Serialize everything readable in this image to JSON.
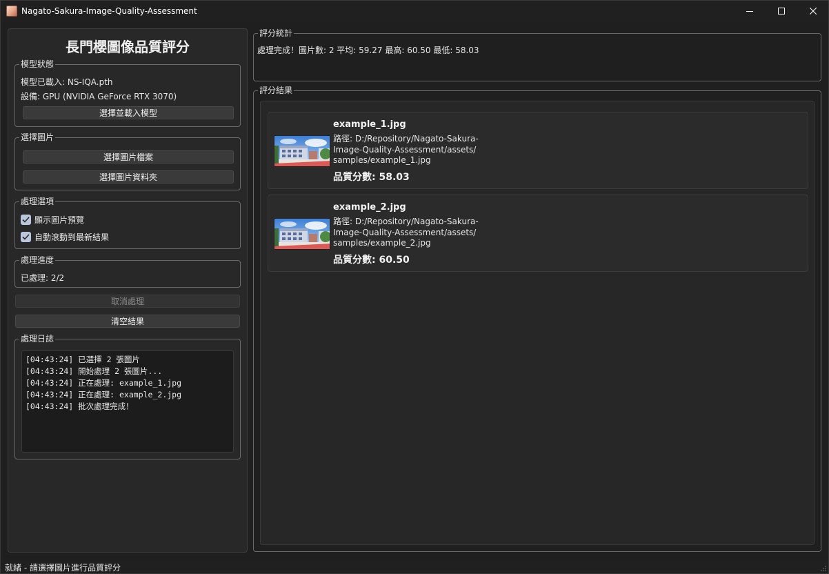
{
  "window": {
    "title": "Nagato-Sakura-Image-Quality-Assessment"
  },
  "app": {
    "heading": "長門櫻圖像品質評分"
  },
  "model_status": {
    "legend": "模型狀態",
    "loaded_text": "模型已載入: NS-IQA.pth",
    "device_text": "設備: GPU (NVIDIA GeForce RTX 3070)",
    "load_button": "選擇並載入模型"
  },
  "select_image": {
    "legend": "選擇圖片",
    "file_button": "選擇圖片檔案",
    "folder_button": "選擇圖片資料夾"
  },
  "options": {
    "legend": "處理選項",
    "show_preview": {
      "label": "顯示圖片預覽",
      "checked": true
    },
    "auto_scroll": {
      "label": "自動滾動到最新結果",
      "checked": true
    }
  },
  "progress": {
    "legend": "處理進度",
    "text": "已處理: 2/2"
  },
  "actions": {
    "cancel_button": "取消處理",
    "clear_button": "清空結果"
  },
  "log": {
    "legend": "處理日誌",
    "lines": [
      "[04:43:24] 已選擇 2 張圖片",
      "[04:43:24] 開始處理 2 張圖片...",
      "[04:43:24] 正在處理: example_1.jpg",
      "[04:43:24] 正在處理: example_2.jpg",
      "[04:43:24] 批次處理完成！"
    ]
  },
  "stats": {
    "legend": "評分統計",
    "summary": "處理完成！圖片數: 2  平均: 59.27  最高: 60.50  最低: 58.03"
  },
  "results": {
    "legend": "評分結果",
    "items": [
      {
        "name": "example_1.jpg",
        "path_lines": [
          "路徑: D:/Repository/Nagato-Sakura-",
          "Image-Quality-Assessment/assets/",
          "samples/example_1.jpg"
        ],
        "score": "品質分數: 58.03"
      },
      {
        "name": "example_2.jpg",
        "path_lines": [
          "路徑: D:/Repository/Nagato-Sakura-",
          "Image-Quality-Assessment/assets/",
          "samples/example_2.jpg"
        ],
        "score": "品質分數: 60.50"
      }
    ]
  },
  "statusbar": {
    "text": "就緒 - 請選擇圖片進行品質評分"
  }
}
